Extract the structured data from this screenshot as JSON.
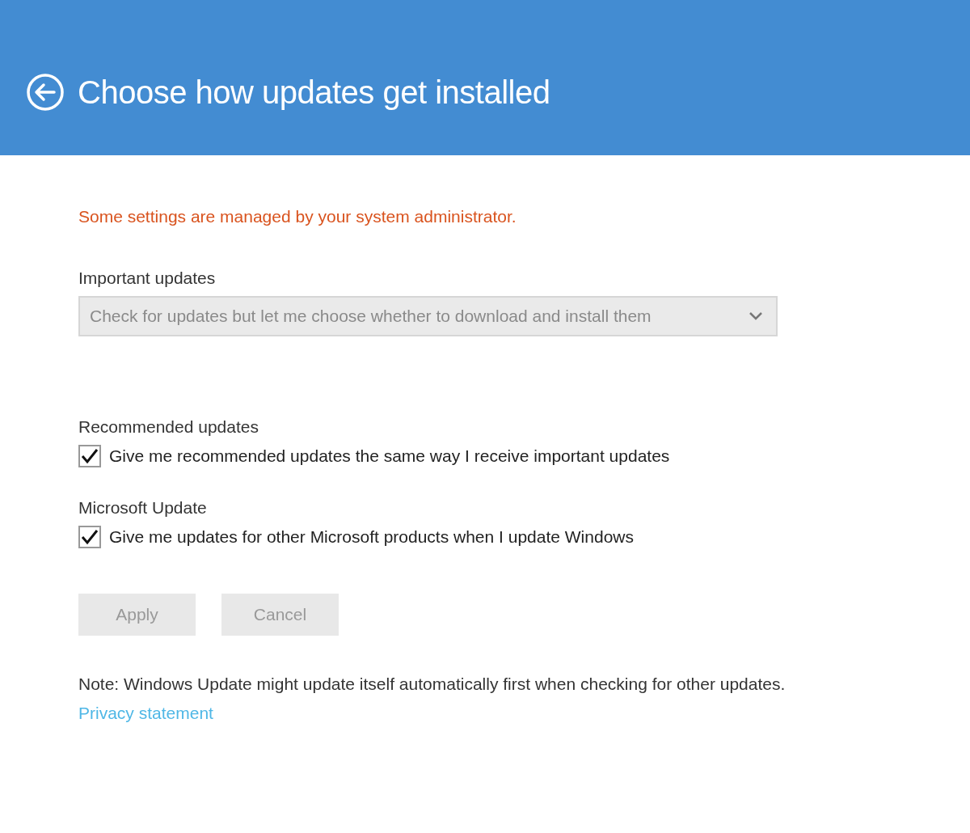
{
  "header": {
    "title": "Choose how updates get installed"
  },
  "warning": "Some settings are managed by your system administrator.",
  "important_updates": {
    "label": "Important updates",
    "dropdown": {
      "value": "Check for updates but let me choose whether to download and install them",
      "disabled": true
    }
  },
  "options": [
    {
      "heading": "Recommended updates",
      "label": "Give me recommended updates the same way I receive important updates",
      "checked": true
    },
    {
      "heading": "Microsoft Update",
      "label": "Give me updates for other Microsoft products when I update Windows",
      "checked": true
    }
  ],
  "buttons": [
    {
      "label": "Apply",
      "disabled": true
    },
    {
      "label": "Cancel",
      "disabled": true
    }
  ],
  "note": "Note: Windows Update might update itself automatically first when checking for other updates.",
  "link": "Privacy statement"
}
